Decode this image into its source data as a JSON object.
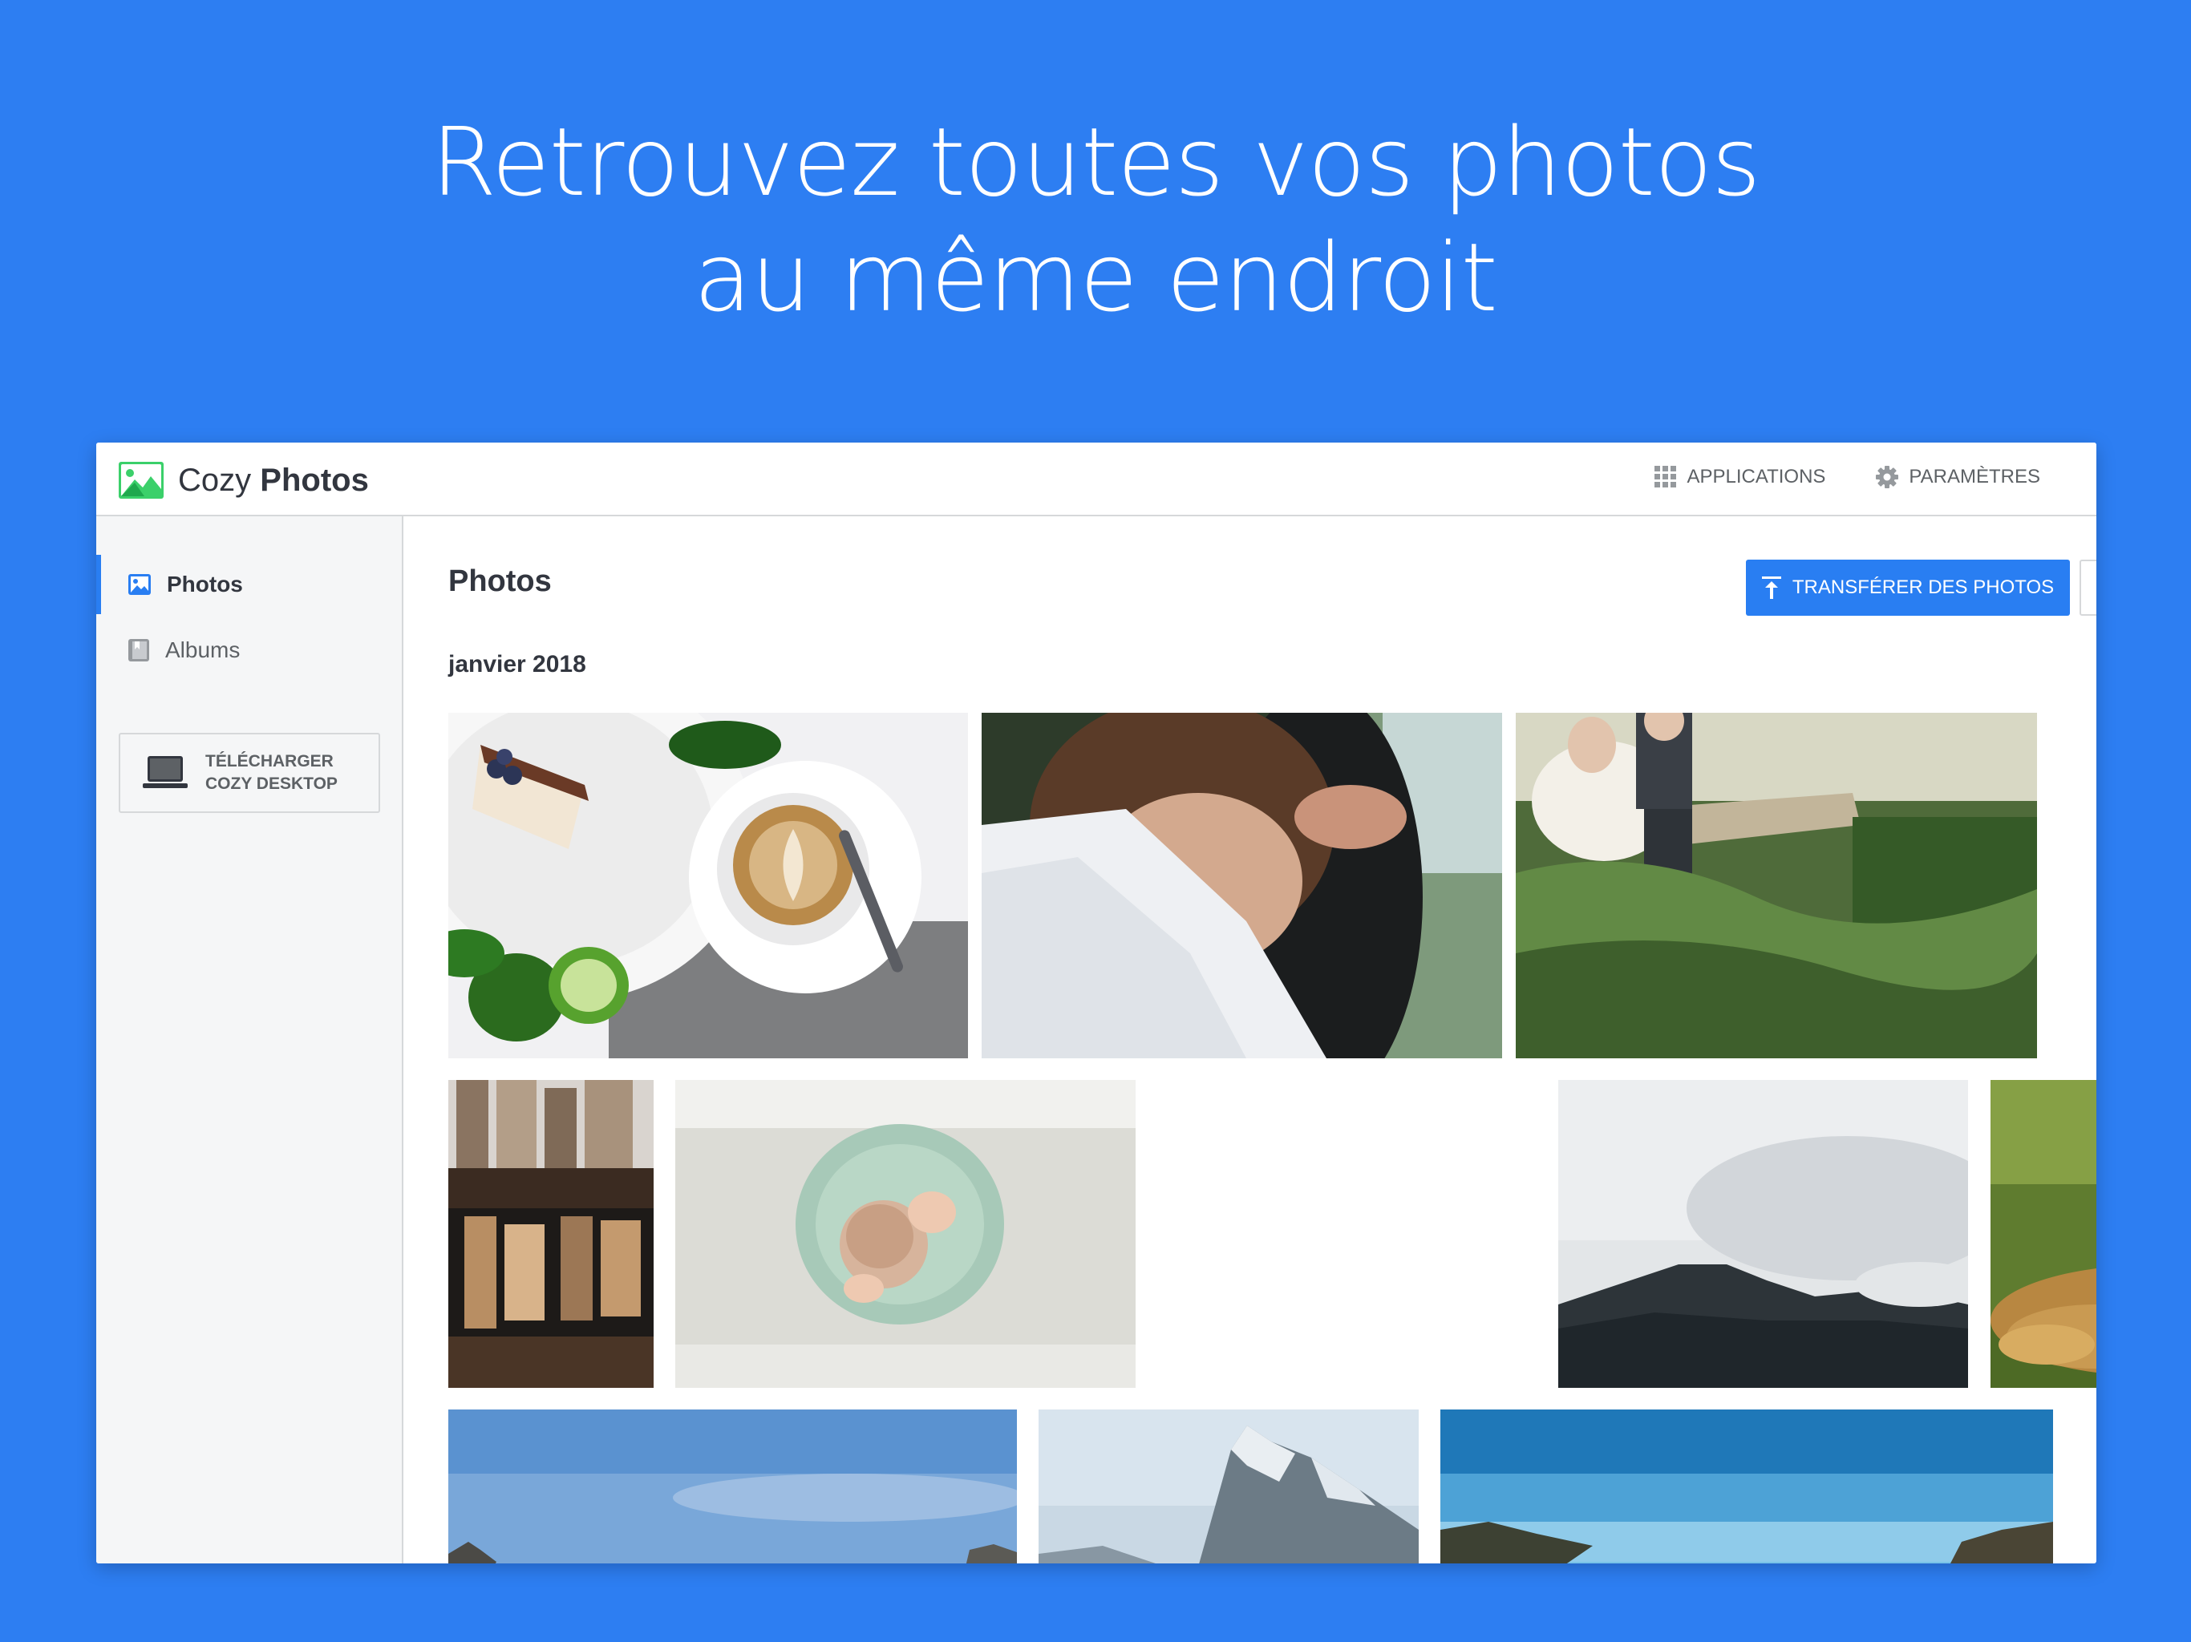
{
  "headline": {
    "line1": "Retrouvez toutes vos photos",
    "line2": "au même endroit"
  },
  "app": {
    "name_light": "Cozy",
    "name_bold": "Photos",
    "logo_icon": "cozy-photos-logo-icon",
    "accent_color": "#297ef2",
    "background_color": "#2d7ef2"
  },
  "topbar": {
    "applications_label": "APPLICATIONS",
    "applications_icon": "grid-icon",
    "settings_label": "PARAMÈTRES",
    "settings_icon": "gear-icon"
  },
  "sidebar": {
    "items": [
      {
        "label": "Photos",
        "icon": "image-icon",
        "active": true
      },
      {
        "label": "Albums",
        "icon": "album-icon",
        "active": false
      }
    ],
    "download": {
      "line1": "TÉLÉCHARGER",
      "line2": "COZY DESKTOP",
      "icon": "laptop-icon"
    }
  },
  "main": {
    "title": "Photos",
    "upload_label": "TRANSFÉRER DES PHOTOS",
    "upload_icon": "upload-icon",
    "more_icon": "more-icon",
    "sections": [
      {
        "date": "janvier 2018",
        "photos": [
          "cake-and-coffee",
          "bride-veil",
          "couple-on-bench",
          "city-reflection",
          "baby-on-bed",
          "misty-mountain",
          "roaring-lion",
          "sky-mountains",
          "rocky-peak",
          "blue-sky-hills"
        ]
      }
    ]
  },
  "fab_icon": "cozy-cloud-icon"
}
